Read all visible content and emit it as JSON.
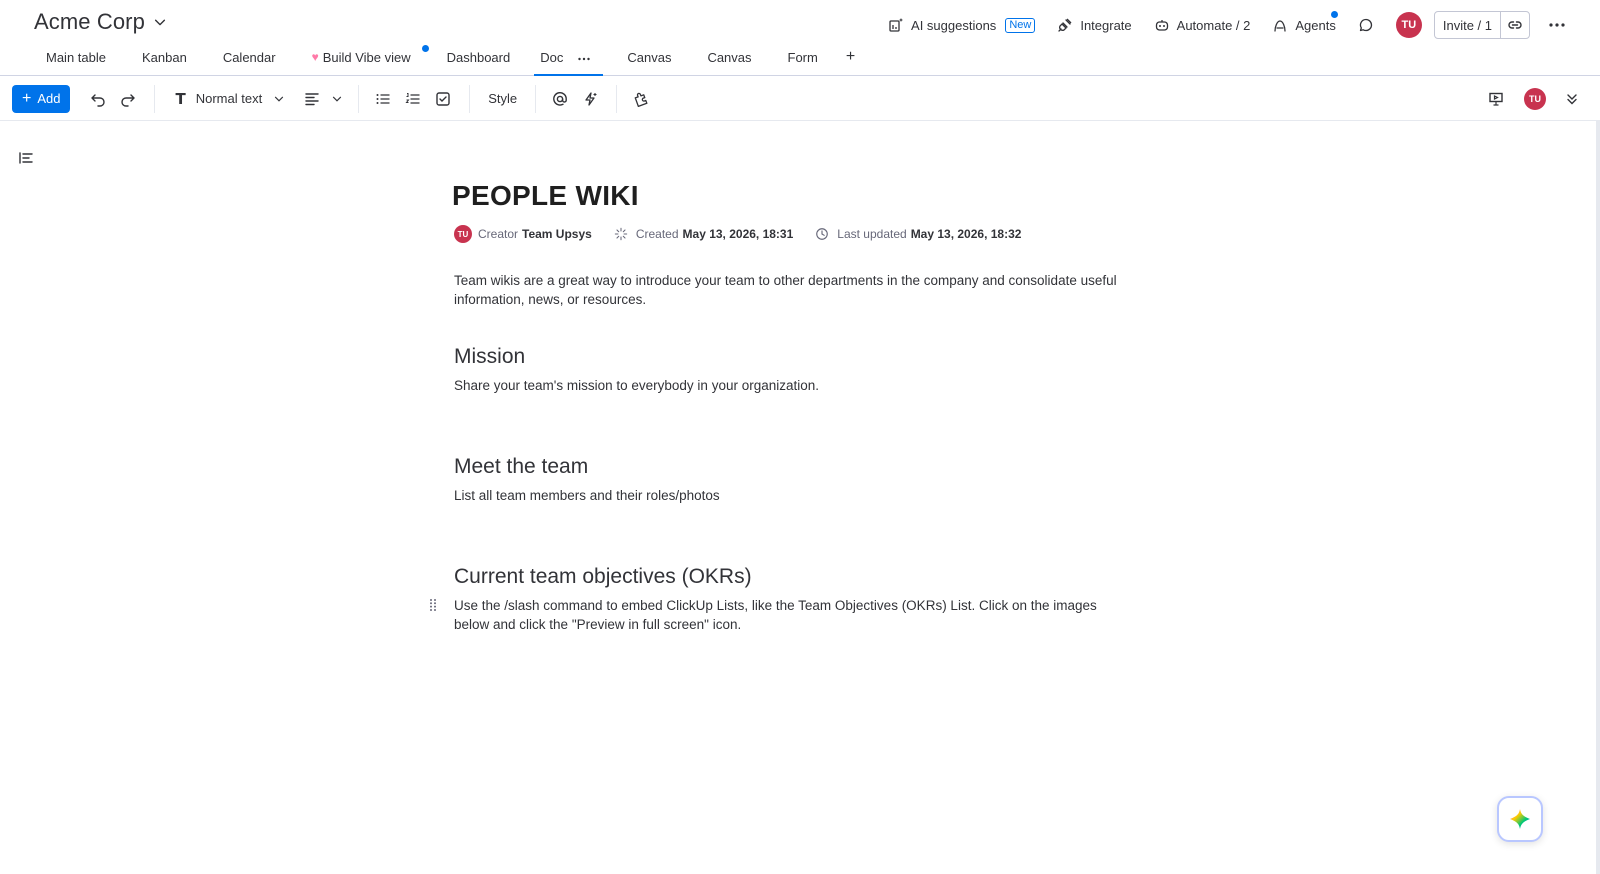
{
  "header": {
    "board_title": "Acme Corp",
    "tabs": [
      {
        "label": "Main table"
      },
      {
        "label": "Kanban"
      },
      {
        "label": "Calendar"
      },
      {
        "label": "Build Vibe view"
      },
      {
        "label": "Dashboard"
      },
      {
        "label": "Doc"
      },
      {
        "label": "Canvas"
      },
      {
        "label": "Canvas"
      },
      {
        "label": "Form"
      }
    ],
    "add_tab": "+",
    "actions": {
      "ai_suggestions": "AI suggestions",
      "ai_badge": "New",
      "integrate": "Integrate",
      "automate": "Automate / 2",
      "agents": "Agents",
      "invite": "Invite / 1"
    },
    "user_initials": "TU"
  },
  "toolbar": {
    "add_label": "Add",
    "add_plus": "+",
    "text_style_glyph": "T",
    "text_style": "Normal text",
    "style_label": "Style",
    "user_initials": "TU"
  },
  "doc": {
    "title": "PEOPLE WIKI",
    "meta": {
      "creator_initials": "TU",
      "creator_label": "Creator",
      "creator_name": "Team Upsys",
      "created_label": "Created",
      "created_value": "May 13, 2026, 18:31",
      "updated_label": "Last updated",
      "updated_value": "May 13, 2026, 18:32"
    },
    "intro": "Team wikis are a great way to introduce your team to other departments in the company and consolidate useful information, news, or resources.",
    "sections": [
      {
        "heading": "Mission",
        "body": "Share your team's mission to everybody in your organization."
      },
      {
        "heading": "Meet the team",
        "body": "List all team members and their roles/photos"
      },
      {
        "heading": "Current team objectives (OKRs)",
        "body": "Use the /slash command to embed ClickUp Lists, like the Team Objectives (OKRs) List. Click on the images below and click the \"Preview in full screen\" icon."
      }
    ]
  },
  "colors": {
    "accent": "#0073ea",
    "avatar": "#c8334f",
    "text": "#323338"
  }
}
